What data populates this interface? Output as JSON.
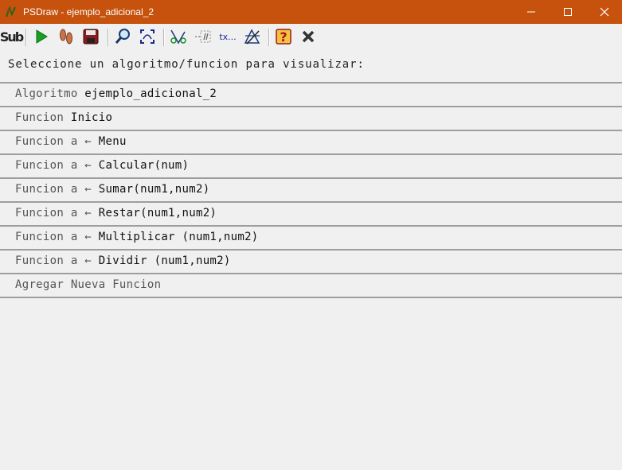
{
  "window": {
    "title": "PSDraw - ejemplo_adicional_2"
  },
  "toolbar": {
    "buttons": [
      {
        "id": "sub",
        "label": "Sub",
        "icon": "sub-icon"
      },
      {
        "id": "run",
        "icon": "play-icon"
      },
      {
        "id": "step",
        "icon": "footsteps-icon"
      },
      {
        "id": "save",
        "icon": "save-disk-icon"
      },
      {
        "id": "zoom",
        "icon": "zoom-icon"
      },
      {
        "id": "fit",
        "icon": "fit-window-icon"
      },
      {
        "id": "cut",
        "icon": "cut-icon"
      },
      {
        "id": "comments",
        "icon": "comment-icon"
      },
      {
        "id": "text",
        "label": "tx...",
        "icon": "text-icon"
      },
      {
        "id": "crop",
        "icon": "crop-icon"
      },
      {
        "id": "help",
        "icon": "help-icon"
      },
      {
        "id": "close",
        "icon": "close-x-icon"
      }
    ]
  },
  "prompt": "Seleccione un algoritmo/funcion para visualizar:",
  "functions": [
    {
      "kw": "Algoritmo",
      "name": "ejemplo_adicional_2"
    },
    {
      "kw": "Funcion",
      "name": "Inicio"
    },
    {
      "kw": "Funcion a ←",
      "name": "Menu"
    },
    {
      "kw": "Funcion a ←",
      "name": "Calcular(num)"
    },
    {
      "kw": "Funcion a ←",
      "name": "Sumar(num1,num2)"
    },
    {
      "kw": "Funcion a ←",
      "name": "Restar(num1,num2)"
    },
    {
      "kw": "Funcion a ←",
      "name": "Multiplicar (num1,num2)"
    },
    {
      "kw": "Funcion a ←",
      "name": "Dividir (num1,num2)"
    },
    {
      "kw": "Agregar Nueva Funcion",
      "name": ""
    }
  ],
  "colors": {
    "titlebar": "#c6520e",
    "background": "#f0f0f0",
    "divider": "#9e9e9e"
  }
}
